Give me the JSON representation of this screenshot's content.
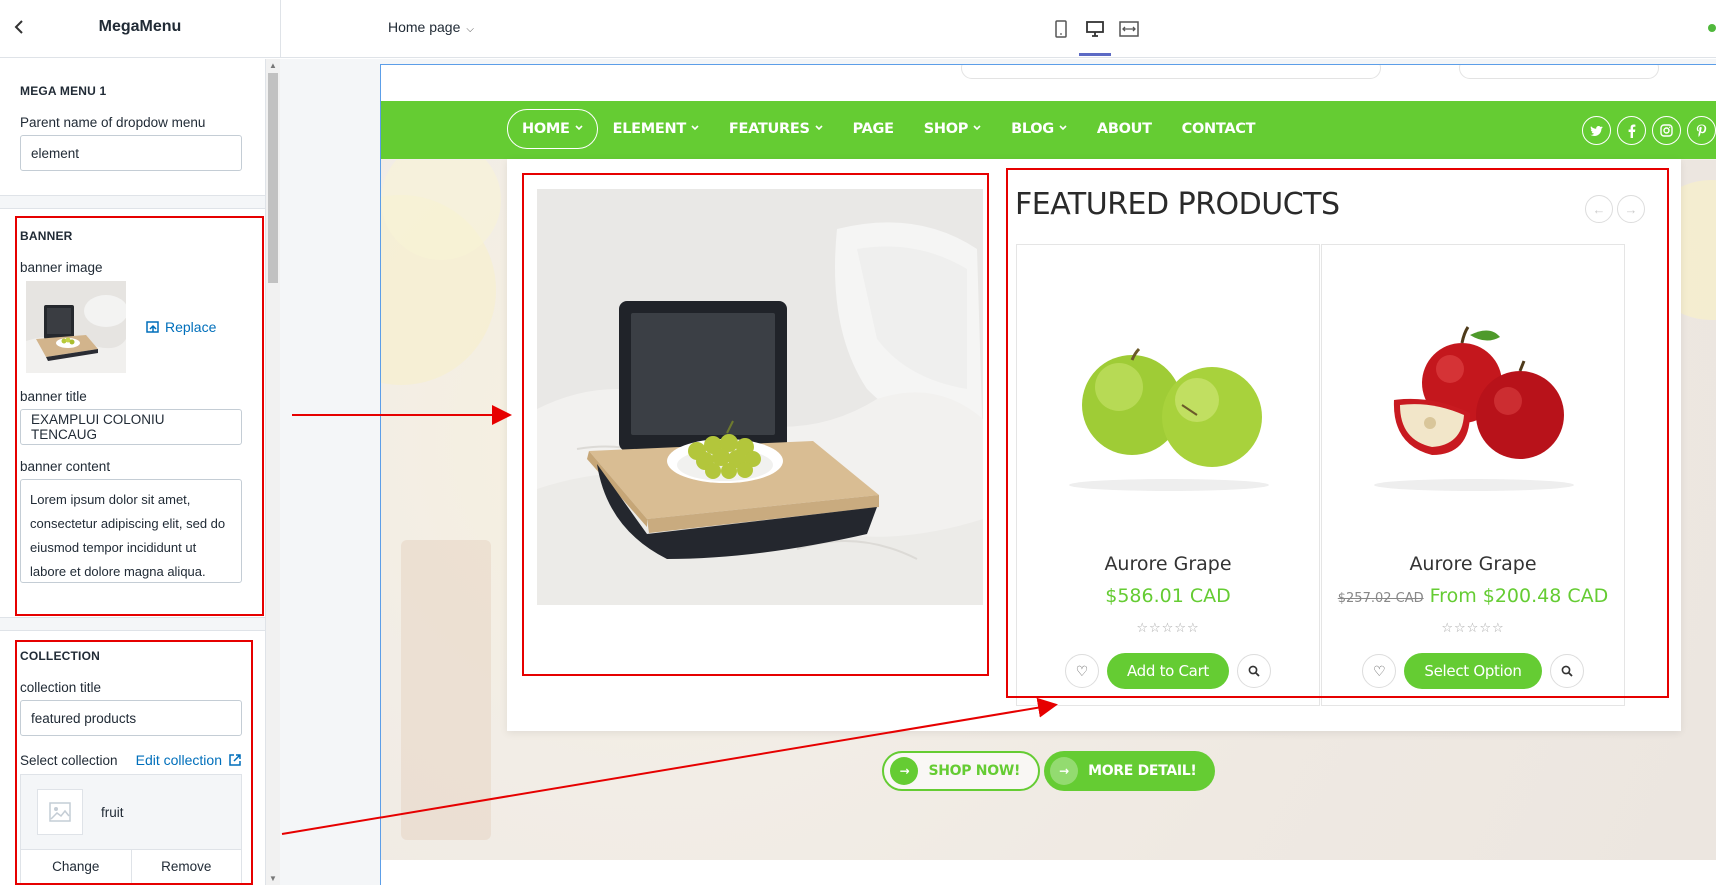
{
  "topbar": {
    "back_icon": "chevron-left-icon",
    "panel_title": "MegaMenu",
    "page_select": "Home page",
    "devices": [
      "mobile-icon",
      "desktop-icon",
      "full-width-icon"
    ],
    "status_color": "#50b83c"
  },
  "sidebar": {
    "mega_menu": {
      "heading": "MEGA MENU 1",
      "parent_label": "Parent name of dropdow menu",
      "parent_value": "element"
    },
    "banner": {
      "heading": "BANNER",
      "image_label": "banner image",
      "replace_label": "Replace",
      "title_label": "banner title",
      "title_value": "EXAMPLUI COLONIU TENCAUG",
      "content_label": "banner content",
      "content_value": "Lorem ipsum dolor sit amet, consectetur adipiscing elit, sed do eiusmod tempor incididunt ut labore et dolore magna aliqua."
    },
    "collection": {
      "heading": "COLLECTION",
      "title_label": "collection title",
      "title_value": "featured products",
      "select_label": "Select collection",
      "edit_label": "Edit collection",
      "selected_name": "fruit",
      "change_label": "Change",
      "remove_label": "Remove"
    }
  },
  "store": {
    "nav": [
      {
        "label": "HOME",
        "dropdown": true
      },
      {
        "label": "ELEMENT",
        "dropdown": true
      },
      {
        "label": "FEATURES",
        "dropdown": true
      },
      {
        "label": "PAGE",
        "dropdown": false
      },
      {
        "label": "SHOP",
        "dropdown": true
      },
      {
        "label": "BLOG",
        "dropdown": true
      },
      {
        "label": "ABOUT",
        "dropdown": false
      },
      {
        "label": "CONTACT",
        "dropdown": false
      }
    ],
    "social": [
      "twitter-icon",
      "facebook-icon",
      "instagram-icon",
      "pinterest-icon"
    ],
    "accent": "#65cc33",
    "mega": {
      "featured_title": "FEATURED PRODUCTS",
      "products": [
        {
          "name": "Aurore Grape",
          "old_price": "",
          "price": "$586.01 CAD",
          "button": "Add to Cart"
        },
        {
          "name": "Aurore Grape",
          "old_price": "$257.02 CAD",
          "price": "From $200.48 CAD",
          "button": "Select Option"
        }
      ]
    },
    "hero": {
      "shop_now": "SHOP NOW!",
      "more_detail": "MORE DETAIL!"
    }
  }
}
